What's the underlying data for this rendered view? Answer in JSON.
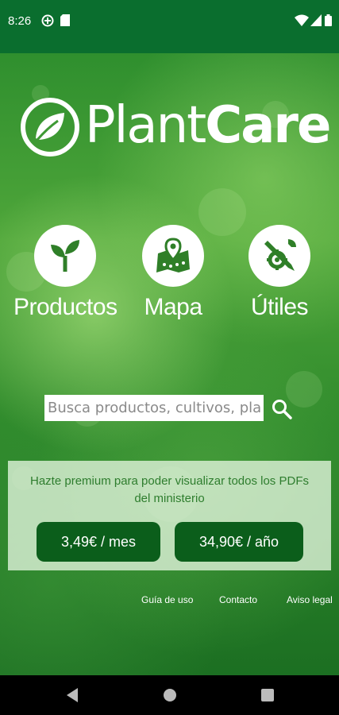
{
  "status_bar": {
    "time": "8:26",
    "bg_color": "#0a6e2e"
  },
  "logo": {
    "text_light": "Plant",
    "text_bold": "Care",
    "icon": "leaf-logo-icon"
  },
  "features": [
    {
      "label": "Productos",
      "icon": "seedling-icon"
    },
    {
      "label": "Mapa",
      "icon": "map-pin-icon"
    },
    {
      "label": "Útiles",
      "icon": "tools-icon"
    }
  ],
  "search": {
    "placeholder": "Busca productos, cultivos, plagas"
  },
  "premium": {
    "message": "Hazte premium para poder visualizar todos los PDFs del ministerio",
    "monthly_label": "3,49€ / mes",
    "yearly_label": "34,90€ / año",
    "button_color": "#0b5e1b"
  },
  "footer": {
    "links": [
      "Guía de uso",
      "Contacto",
      "Aviso legal"
    ]
  }
}
